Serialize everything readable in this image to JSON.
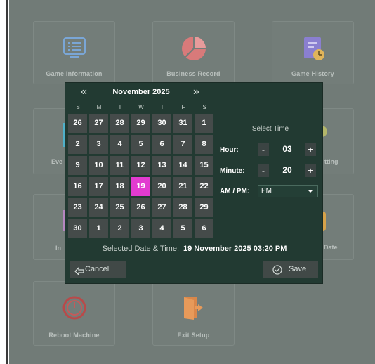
{
  "tiles": {
    "game_information": "Game Information",
    "business_record": "Business Record",
    "game_history": "Game History",
    "events_partial": "Eve",
    "setting_partial": "tting",
    "input_partial": "In",
    "date_partial": "Date",
    "reboot_machine": "Reboot Machine",
    "exit_setup": "Exit Setup"
  },
  "calendar": {
    "month_label": "November 2025",
    "prev_label": "«",
    "next_label": "»",
    "weekdays": [
      "S",
      "M",
      "T",
      "W",
      "T",
      "F",
      "S"
    ],
    "days": [
      "26",
      "27",
      "28",
      "29",
      "30",
      "31",
      "1",
      "2",
      "3",
      "4",
      "5",
      "6",
      "7",
      "8",
      "9",
      "10",
      "11",
      "12",
      "13",
      "14",
      "15",
      "16",
      "17",
      "18",
      "19",
      "20",
      "21",
      "22",
      "23",
      "24",
      "25",
      "26",
      "27",
      "28",
      "29",
      "30",
      "1",
      "2",
      "3",
      "4",
      "5",
      "6"
    ],
    "selected_day": "19",
    "selected_color": "#e23bd0"
  },
  "time": {
    "title": "Select Time",
    "hour_label": "Hour:",
    "hour_value": "03",
    "minute_label": "Minute:",
    "minute_value": "20",
    "ampm_label": "AM / PM:",
    "ampm_value": "PM",
    "minus": "-",
    "plus": "+"
  },
  "summary": {
    "label": "Selected Date & Time:",
    "value": "19 November 2025 03:20 PM"
  },
  "buttons": {
    "cancel": "Cancel",
    "save": "Save"
  }
}
